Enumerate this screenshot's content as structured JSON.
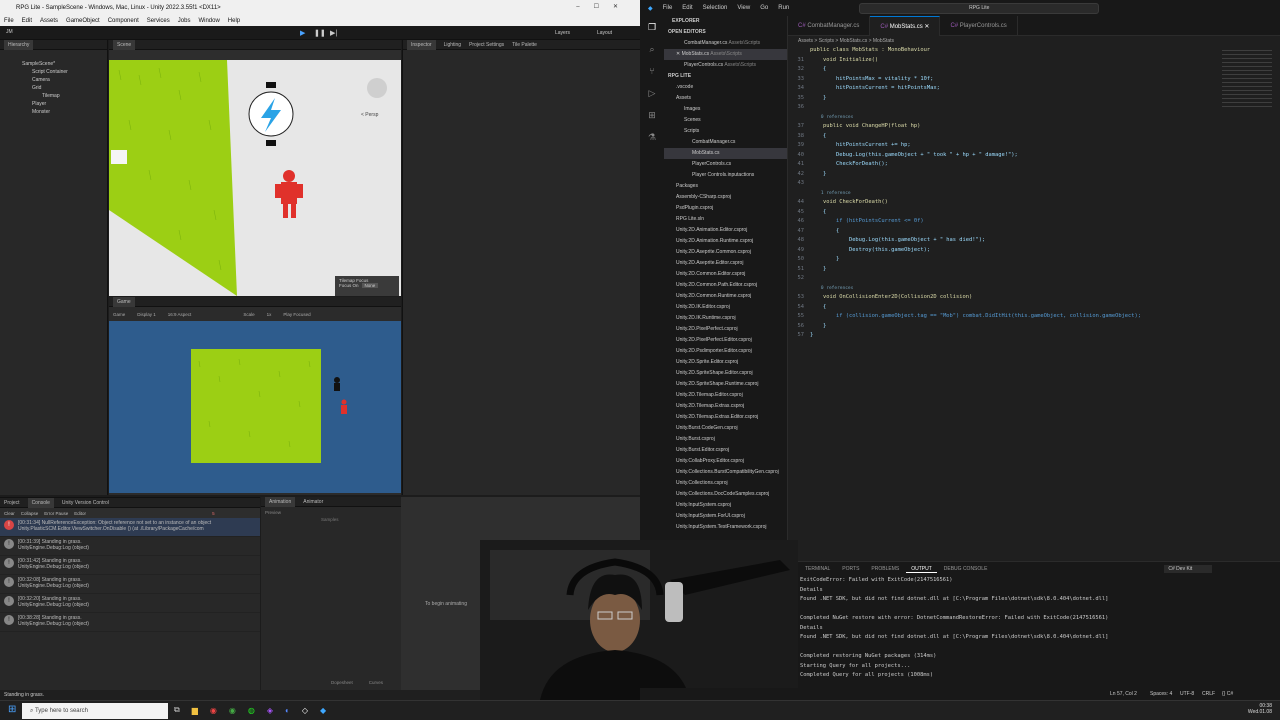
{
  "unity": {
    "window_title": "RPG Lite - SampleScene - Windows, Mac, Linux - Unity 2022.3.55f1 <DX11>",
    "menu": [
      "File",
      "Edit",
      "Assets",
      "GameObject",
      "Component",
      "Services",
      "Jobs",
      "Window",
      "Help"
    ],
    "toolbar": {
      "account": "JM",
      "layers": "Layers",
      "layout": "Layout"
    },
    "hierarchy": {
      "tab": "Hierarchy",
      "items": [
        "SampleScene*",
        "Script Container",
        "Camera",
        "Grid",
        "Tilemap",
        "Player",
        "Monster"
      ]
    },
    "scene_tabs": [
      "Scene"
    ],
    "scene_labels": {
      "persp": "< Persp",
      "tilemap_focus": "Tilemap Focus",
      "focus_on": "Focus On",
      "none": "None"
    },
    "game_tabs": [
      "Game"
    ],
    "game_toolbar": {
      "mode": "Game",
      "display": "Display 1",
      "aspect": "16:9 Aspect",
      "scale_label": "Scale",
      "scale": "1x",
      "play_focused": "Play Focused"
    },
    "inspector_tabs": [
      "Inspector",
      "Lighting",
      "Project Settings",
      "Tile Palette"
    ],
    "console": {
      "tabs": [
        "Project",
        "Console",
        "Unity Version Control"
      ],
      "toolbar": [
        "Clear",
        "Collapse",
        "Error Pause",
        "Editor"
      ],
      "count": "5",
      "entries": [
        {
          "kind": "error",
          "line1": "[00:31:34] NullReferenceException: Object reference not set to an instance of an object",
          "line2": "Unity.PlasticSCM.Editor.ViewSwitcher.OnDisable () (at ./Library/PackageCache/com"
        },
        {
          "kind": "log",
          "line1": "[00:31:39] Standing in grass.",
          "line2": "UnityEngine.Debug:Log (object)"
        },
        {
          "kind": "log",
          "line1": "[00:31:42] Standing in grass.",
          "line2": "UnityEngine.Debug:Log (object)"
        },
        {
          "kind": "log",
          "line1": "[00:32:08] Standing in grass.",
          "line2": "UnityEngine.Debug:Log (object)"
        },
        {
          "kind": "log",
          "line1": "[00:32:20] Standing in grass.",
          "line2": "UnityEngine.Debug:Log (object)"
        },
        {
          "kind": "log",
          "line1": "[00:38:28] Standing in grass.",
          "line2": "UnityEngine.Debug:Log (object)"
        }
      ]
    },
    "animation": {
      "tabs": [
        "Animation",
        "Animator"
      ],
      "preview": "Preview",
      "samples": "Samples",
      "hint": "To begin animating",
      "footer": [
        "Dopesheet",
        "Curves"
      ]
    },
    "status": "Standing in grass."
  },
  "vscode": {
    "menu": [
      "File",
      "Edit",
      "Selection",
      "View",
      "Go",
      "Run"
    ],
    "search": "RPG Lite",
    "explorer": {
      "title": "EXPLORER",
      "open_editors": "OPEN EDITORS",
      "open_files": [
        {
          "name": "CombatManager.cs",
          "path": "Assets\\Scripts"
        },
        {
          "name": "MobStats.cs",
          "path": "Assets\\Scripts"
        },
        {
          "name": "PlayerControls.cs",
          "path": "Assets\\Scripts"
        }
      ],
      "workspace": "RPG LITE",
      "tree": [
        ".vscode",
        "Assets",
        "Images",
        "Scenes",
        "Scripts",
        "CombatManager.cs",
        "MobStats.cs",
        "PlayerControls.cs",
        "Player Controls.inputactions",
        "Packages",
        "Assembly-CSharp.csproj",
        "PsdPlugin.csproj",
        "RPG Lite.sln",
        "Unity.2D.Animation.Editor.csproj",
        "Unity.2D.Animation.Runtime.csproj",
        "Unity.2D.Aseprite.Common.csproj",
        "Unity.2D.Aseprite.Editor.csproj",
        "Unity.2D.Common.Editor.csproj",
        "Unity.2D.Common.Path.Editor.csproj",
        "Unity.2D.Common.Runtime.csproj",
        "Unity.2D.IK.Editor.csproj",
        "Unity.2D.IK.Runtime.csproj",
        "Unity.2D.PixelPerfect.csproj",
        "Unity.2D.PixelPerfect.Editor.csproj",
        "Unity.2D.Psdimporter.Editor.csproj",
        "Unity.2D.Sprite.Editor.csproj",
        "Unity.2D.SpriteShape.Editor.csproj",
        "Unity.2D.SpriteShape.Runtime.csproj",
        "Unity.2D.Tilemap.Editor.csproj",
        "Unity.2D.Tilemap.Extras.csproj",
        "Unity.2D.Tilemap.Extras.Editor.csproj",
        "Unity.Burst.CodeGen.csproj",
        "Unity.Burst.csproj",
        "Unity.Burst.Editor.csproj",
        "Unity.CollabProxy.Editor.csproj",
        "Unity.Collections.BurstCompatibilityGen.csproj",
        "Unity.Collections.csproj",
        "Unity.Collections.DocCodeSamples.csproj",
        "Unity.InputSystem.csproj",
        "Unity.InputSystem.ForUI.csproj",
        "Unity.InputSystem.TestFramework.csproj"
      ]
    },
    "tabs": [
      "CombatManager.cs",
      "MobStats.cs",
      "PlayerControls.cs"
    ],
    "active_tab": "MobStats.cs",
    "breadcrumb": "Assets > Scripts > MobStats.cs > MobStats",
    "code": [
      {
        "n": "",
        "t": "public class MobStats : MonoBehaviour"
      },
      {
        "n": "31",
        "t": "    void Initialize()"
      },
      {
        "n": "32",
        "t": "    {"
      },
      {
        "n": "33",
        "t": "        hitPointsMax = vitality * 10f;"
      },
      {
        "n": "34",
        "t": "        hitPointsCurrent = hitPointsMax;"
      },
      {
        "n": "35",
        "t": "    }"
      },
      {
        "n": "36",
        "t": ""
      },
      {
        "n": "",
        "t": "    0 references"
      },
      {
        "n": "37",
        "t": "    public void ChangeHP(float hp)"
      },
      {
        "n": "38",
        "t": "    {"
      },
      {
        "n": "39",
        "t": "        hitPointsCurrent += hp;"
      },
      {
        "n": "40",
        "t": "        Debug.Log(this.gameObject + \" took \" + hp + \" damage!\");"
      },
      {
        "n": "41",
        "t": "        CheckForDeath();"
      },
      {
        "n": "42",
        "t": "    }"
      },
      {
        "n": "43",
        "t": ""
      },
      {
        "n": "",
        "t": "    1 reference"
      },
      {
        "n": "44",
        "t": "    void CheckForDeath()"
      },
      {
        "n": "45",
        "t": "    {"
      },
      {
        "n": "46",
        "t": "        if (hitPointsCurrent <= 0f)"
      },
      {
        "n": "47",
        "t": "        {"
      },
      {
        "n": "48",
        "t": "            Debug.Log(this.gameObject + \" has died!\");"
      },
      {
        "n": "49",
        "t": "            Destroy(this.gameObject);"
      },
      {
        "n": "50",
        "t": "        }"
      },
      {
        "n": "51",
        "t": "    }"
      },
      {
        "n": "52",
        "t": ""
      },
      {
        "n": "",
        "t": "    0 references"
      },
      {
        "n": "53",
        "t": "    void OnCollisionEnter2D(Collision2D collision)"
      },
      {
        "n": "54",
        "t": "    {"
      },
      {
        "n": "55",
        "t": "        if (collision.gameObject.tag == \"Mob\") combat.DidItHit(this.gameObject, collision.gameObject);"
      },
      {
        "n": "56",
        "t": "    }"
      },
      {
        "n": "57",
        "t": "}"
      }
    ],
    "panel": {
      "tabs": [
        "TERMINAL",
        "PORTS",
        "PROBLEMS",
        "OUTPUT",
        "DEBUG CONSOLE"
      ],
      "active": "OUTPUT",
      "channel": "C# Dev Kit",
      "lines": [
        "ExitCodeError: Failed with ExitCode(2147516561)",
        "Details",
        "Found .NET SDK, but did not find dotnet.dll at [C:\\Program Files\\dotnet\\sdk\\8.0.404\\dotnet.dll]",
        "",
        "Completed NuGet restore with error: DotnetCommandRestoreError: Failed with ExitCode(2147516561)",
        "Details",
        "Found .NET SDK, but did not find dotnet.dll at [C:\\Program Files\\dotnet\\sdk\\8.0.404\\dotnet.dll]",
        "",
        "Completed restoring NuGet packages (314ms)",
        "Starting Query for all projects...",
        "Completed Query for all projects (1008ms)"
      ]
    },
    "status": {
      "cursor": "Ln 57, Col 2",
      "spaces": "Spaces: 4",
      "encoding": "UTF-8",
      "eol": "CRLF",
      "lang": "{} C#"
    }
  },
  "taskbar": {
    "search_placeholder": "Type here to search",
    "time": "00:38",
    "date": "Wed.01.08"
  },
  "colors": {
    "grass": "#9ccf14",
    "enemy": "#e0312b",
    "game_bg": "#2e5c8d",
    "accent": "#0078d4"
  }
}
